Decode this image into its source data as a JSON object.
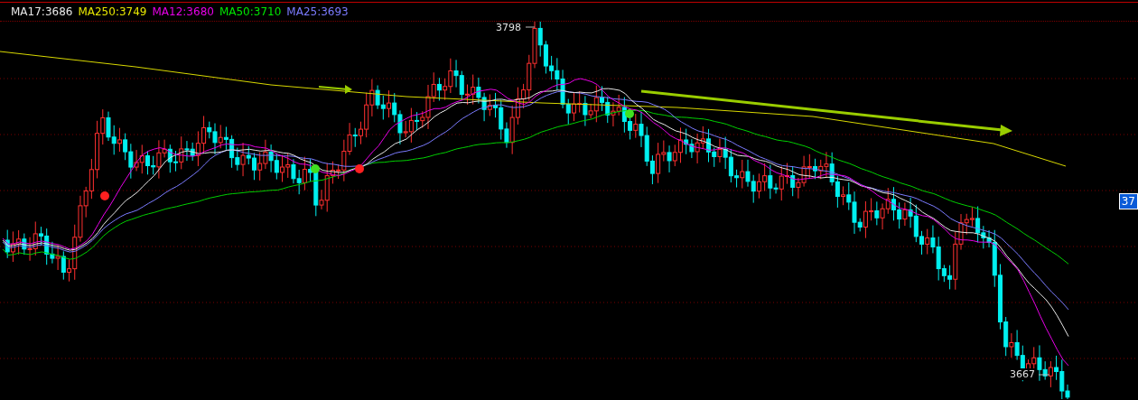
{
  "legend": [
    {
      "label": "MA17:3686",
      "color": "#e8e8e8"
    },
    {
      "label": "MA250:3749",
      "color": "#e8e800"
    },
    {
      "label": "MA12:3680",
      "color": "#e800e8"
    },
    {
      "label": "MA50:3710",
      "color": "#00e800"
    },
    {
      "label": "MA25:3693",
      "color": "#7b7bff"
    }
  ],
  "high_label": "3798",
  "low_label": "3667",
  "price_badge": "37"
}
